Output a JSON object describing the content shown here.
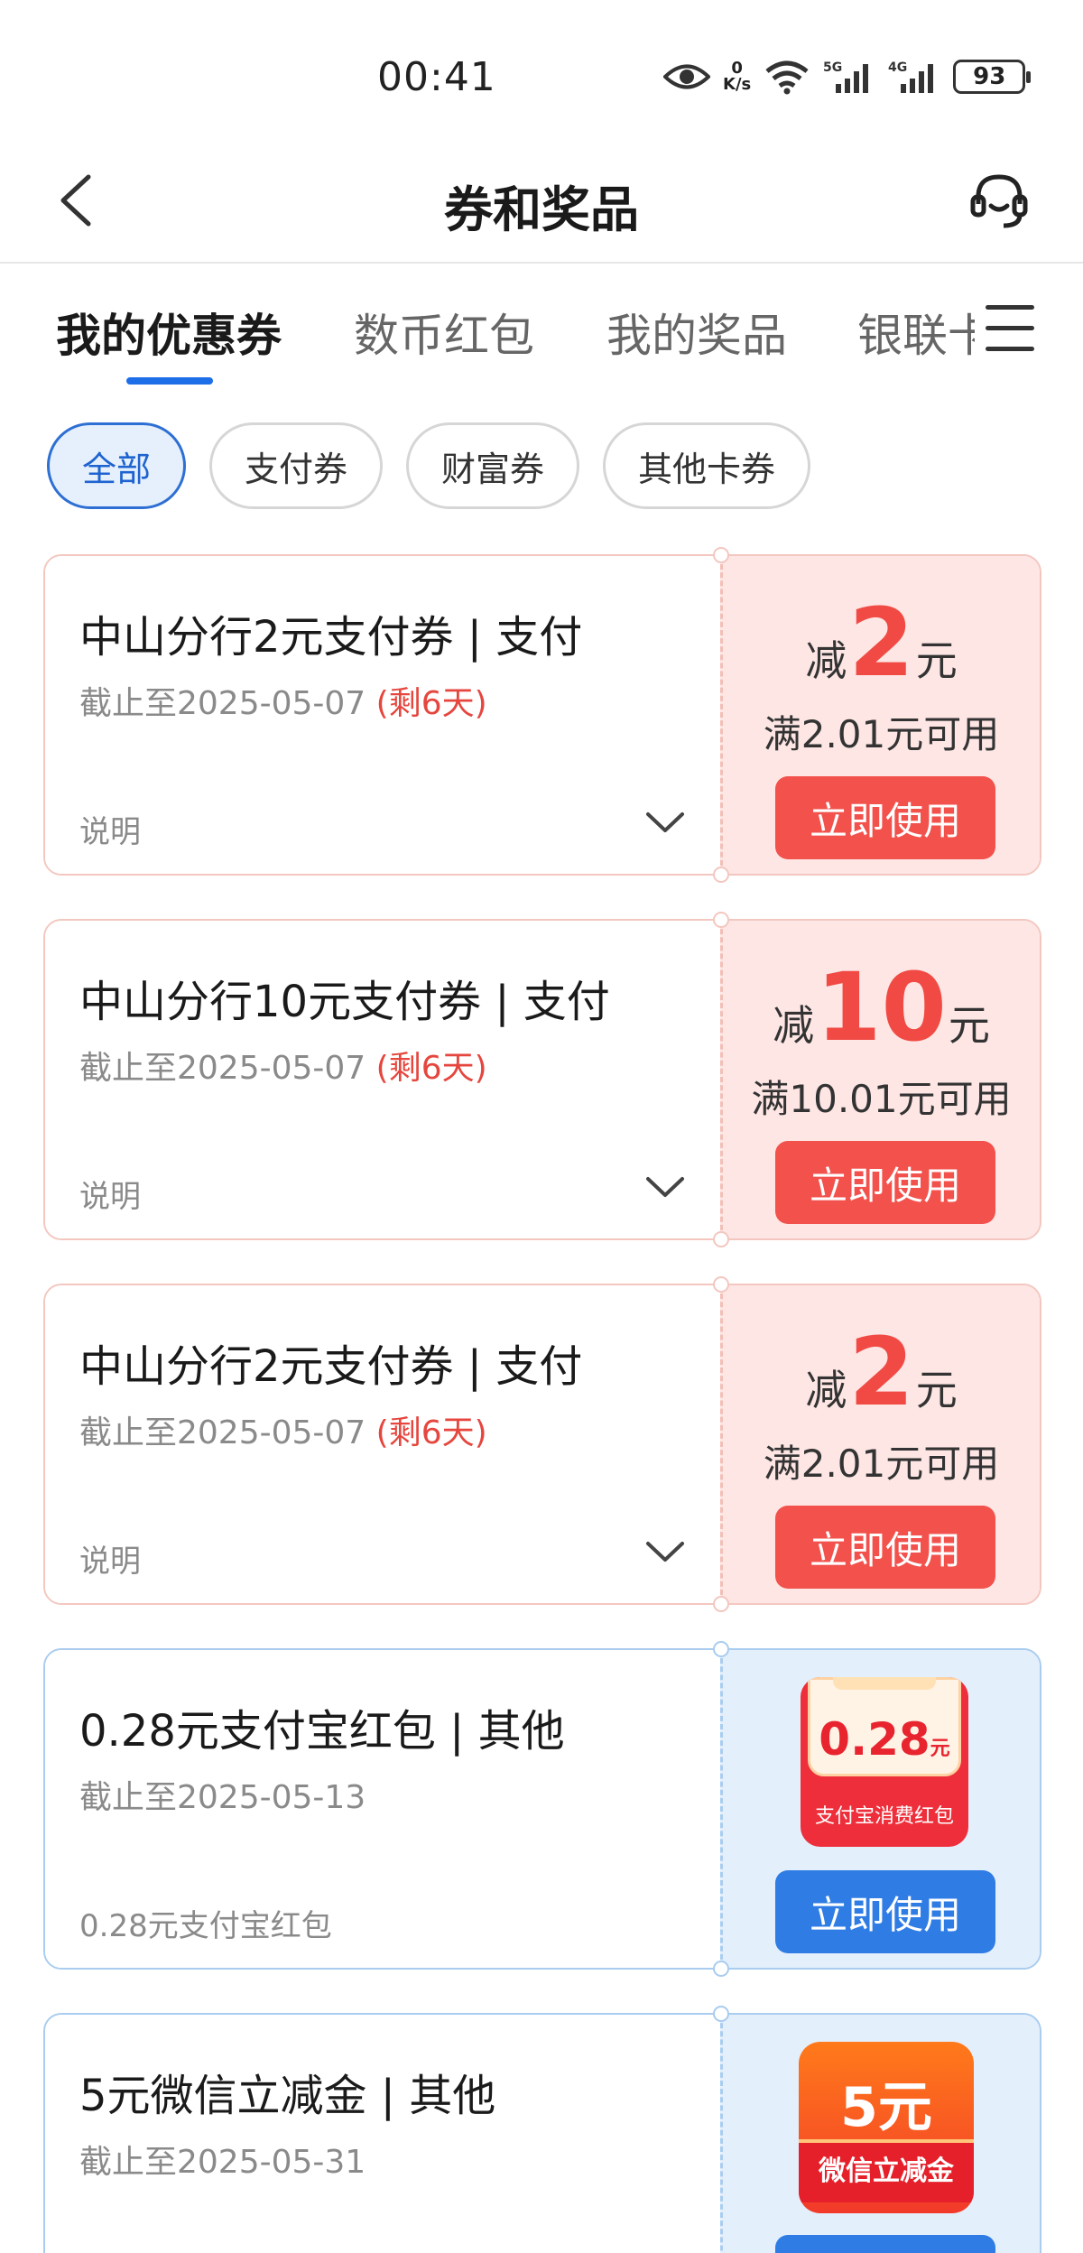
{
  "status_bar": {
    "time": "00:41",
    "speed_value": "0",
    "speed_unit": "K/s",
    "network_1": "5G",
    "network_2": "4G",
    "battery": "93"
  },
  "header": {
    "title": "券和奖品"
  },
  "tabs": [
    {
      "label": "我的优惠券",
      "active": true
    },
    {
      "label": "数币红包",
      "active": false
    },
    {
      "label": "我的奖品",
      "active": false
    },
    {
      "label": "银联卡",
      "active": false
    }
  ],
  "filters": [
    {
      "label": "全部",
      "active": true
    },
    {
      "label": "支付券",
      "active": false
    },
    {
      "label": "财富券",
      "active": false
    },
    {
      "label": "其他卡券",
      "active": false
    }
  ],
  "coupons": [
    {
      "title": "中山分行2元支付券 | 支付",
      "expiry": "截止至2025-05-07",
      "remaining": "(剩6天)",
      "desc": "说明",
      "amount_prefix": "减",
      "amount": "2",
      "amount_unit": "元",
      "condition": "满2.01元可用",
      "button": "立即使用",
      "theme": "red"
    },
    {
      "title": "中山分行10元支付券 | 支付",
      "expiry": "截止至2025-05-07",
      "remaining": "(剩6天)",
      "desc": "说明",
      "amount_prefix": "减",
      "amount": "10",
      "amount_unit": "元",
      "condition": "满10.01元可用",
      "button": "立即使用",
      "theme": "red"
    },
    {
      "title": "中山分行2元支付券 | 支付",
      "expiry": "截止至2025-05-07",
      "remaining": "(剩6天)",
      "desc": "说明",
      "amount_prefix": "减",
      "amount": "2",
      "amount_unit": "元",
      "condition": "满2.01元可用",
      "button": "立即使用",
      "theme": "red"
    },
    {
      "title": "0.28元支付宝红包 | 其他",
      "expiry": "截止至2025-05-13",
      "desc": "0.28元支付宝红包",
      "badge_amount": "0.28",
      "badge_unit": "元",
      "badge_label": "支付宝消费红包",
      "button": "立即使用",
      "theme": "blue"
    },
    {
      "title": "5元微信立减金 | 其他",
      "expiry": "截止至2025-05-31",
      "badge_amount": "5元",
      "badge_label": "微信立减金",
      "theme": "blue"
    }
  ],
  "colors": {
    "accent_blue": "#1e6ee8",
    "coupon_red": "#f2514c",
    "coupon_red_bg": "#fde6e4",
    "coupon_blue": "#2f7de4",
    "coupon_blue_bg": "#e4effc"
  }
}
